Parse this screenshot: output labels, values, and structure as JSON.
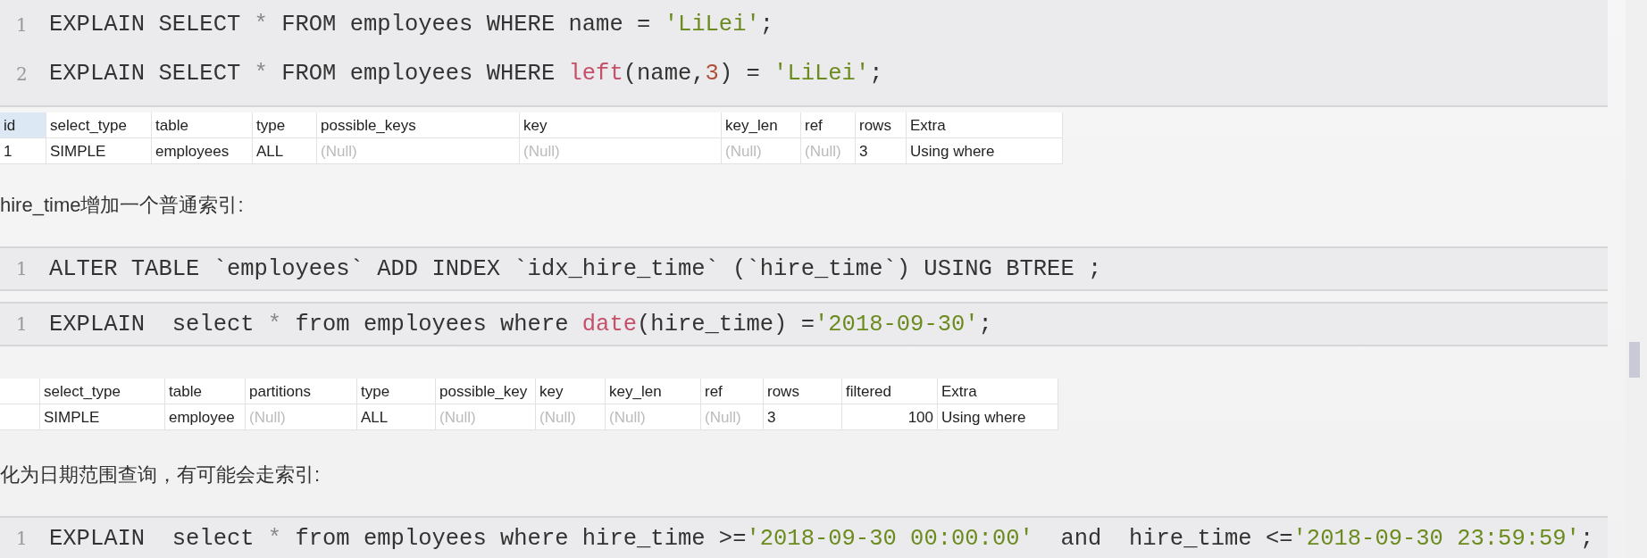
{
  "blocks": [
    {
      "kind": "code",
      "lines": [
        {
          "number": "1",
          "tokens": [
            {
              "kind": "plain",
              "text": "EXPLAIN SELECT "
            },
            {
              "kind": "op",
              "text": "*"
            },
            {
              "kind": "plain",
              "text": " FROM employees WHERE name = "
            },
            {
              "kind": "string",
              "text": "'LiLei'"
            },
            {
              "kind": "plain",
              "text": ";"
            }
          ]
        },
        {
          "number": "2",
          "tokens": [
            {
              "kind": "plain",
              "text": "EXPLAIN SELECT "
            },
            {
              "kind": "op",
              "text": "*"
            },
            {
              "kind": "plain",
              "text": " FROM employees WHERE "
            },
            {
              "kind": "func",
              "text": "left"
            },
            {
              "kind": "plain",
              "text": "(name,"
            },
            {
              "kind": "number",
              "text": "3"
            },
            {
              "kind": "plain",
              "text": ") = "
            },
            {
              "kind": "string",
              "text": "'LiLei'"
            },
            {
              "kind": "plain",
              "text": ";"
            }
          ]
        }
      ]
    },
    {
      "kind": "table",
      "columns": [
        {
          "label": "id",
          "selected": true
        },
        {
          "label": "select_type",
          "selected": false
        },
        {
          "label": "table",
          "selected": false
        },
        {
          "label": "type",
          "selected": false
        },
        {
          "label": "possible_keys",
          "selected": false
        },
        {
          "label": "key",
          "selected": false
        },
        {
          "label": "key_len",
          "selected": false
        },
        {
          "label": "ref",
          "selected": false
        },
        {
          "label": "rows",
          "selected": false
        },
        {
          "label": "Extra",
          "selected": false
        }
      ],
      "rows": [
        [
          {
            "text": "1"
          },
          {
            "text": "SIMPLE"
          },
          {
            "text": "employees"
          },
          {
            "text": "ALL"
          },
          {
            "text": "(Null)",
            "kind": "null"
          },
          {
            "text": "(Null)",
            "kind": "null"
          },
          {
            "text": "(Null)",
            "kind": "null"
          },
          {
            "text": "(Null)",
            "kind": "null"
          },
          {
            "text": "3"
          },
          {
            "text": "Using where"
          }
        ]
      ]
    },
    {
      "kind": "paragraph",
      "text": "hire_time增加一个普通索引:"
    },
    {
      "kind": "code",
      "lines": [
        {
          "number": "1",
          "tokens": [
            {
              "kind": "plain",
              "text": "ALTER TABLE `employees` ADD INDEX `idx_hire_time` (`hire_time`) USING BTREE ;"
            }
          ]
        }
      ]
    },
    {
      "kind": "code",
      "lines": [
        {
          "number": "1",
          "tokens": [
            {
              "kind": "plain",
              "text": "EXPLAIN  select "
            },
            {
              "kind": "op",
              "text": "*"
            },
            {
              "kind": "plain",
              "text": " from employees where "
            },
            {
              "kind": "func",
              "text": "date"
            },
            {
              "kind": "plain",
              "text": "(hire_time) ="
            },
            {
              "kind": "string",
              "text": "'2018-09-30'"
            },
            {
              "kind": "plain",
              "text": ";"
            }
          ]
        }
      ]
    },
    {
      "kind": "table",
      "columns": [
        {
          "selected": false
        },
        {
          "label": "select_type",
          "selected": false
        },
        {
          "label": "table",
          "selected": false
        },
        {
          "label": "partitions",
          "selected": false
        },
        {
          "label": "type",
          "selected": false
        },
        {
          "label": "possible_key",
          "selected": false
        },
        {
          "label": "key",
          "selected": false
        },
        {
          "label": "key_len",
          "selected": false
        },
        {
          "label": "ref",
          "selected": false
        },
        {
          "label": "rows",
          "selected": false
        },
        {
          "label": "filtered",
          "selected": false
        },
        {
          "label": "Extra",
          "selected": false
        }
      ],
      "rows": [
        [
          {
            "kind": "empty"
          },
          {
            "text": "SIMPLE"
          },
          {
            "text": "employee"
          },
          {
            "text": "(Null)",
            "kind": "null"
          },
          {
            "text": "ALL"
          },
          {
            "text": "(Null)",
            "kind": "null"
          },
          {
            "text": "(Null)",
            "kind": "null"
          },
          {
            "text": "(Null)",
            "kind": "null"
          },
          {
            "text": "(Null)",
            "kind": "null"
          },
          {
            "text": "3"
          },
          {
            "text": "100",
            "kind": "numeric"
          },
          {
            "text": "Using where"
          }
        ]
      ]
    },
    {
      "kind": "paragraph",
      "text": "化为日期范围查询，有可能会走索引:"
    },
    {
      "kind": "code",
      "lines": [
        {
          "number": "1",
          "tokens": [
            {
              "kind": "plain",
              "text": "EXPLAIN  select "
            },
            {
              "kind": "op",
              "text": "*"
            },
            {
              "kind": "plain",
              "text": " from employees where hire_time >="
            },
            {
              "kind": "string",
              "text": "'2018-09-30 00:00:00'"
            },
            {
              "kind": "plain",
              "text": "  and  hire_time <="
            },
            {
              "kind": "string",
              "text": "'2018-09-30 23:59:59'"
            },
            {
              "kind": "plain",
              "text": ";"
            }
          ]
        }
      ]
    }
  ]
}
